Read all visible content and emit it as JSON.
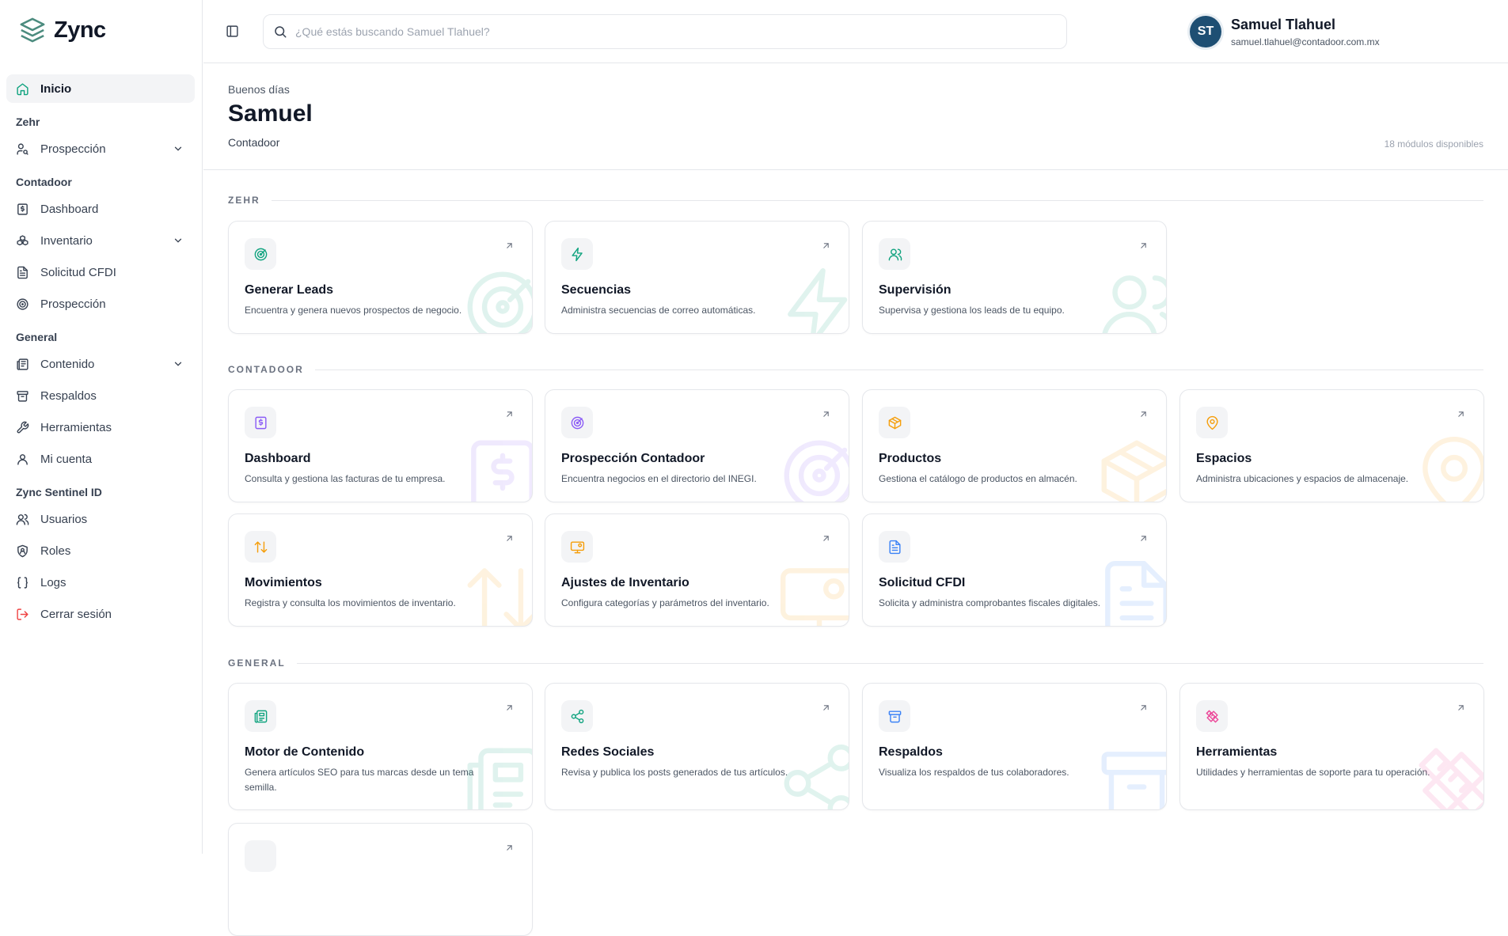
{
  "app": {
    "name": "Zync"
  },
  "sidebar": {
    "home": "Inicio",
    "sections": [
      {
        "title": "Zehr",
        "items": [
          "Prospección"
        ]
      },
      {
        "title": "Contadoor",
        "items": [
          "Dashboard",
          "Inventario",
          "Solicitud CFDI",
          "Prospección"
        ]
      },
      {
        "title": "General",
        "items": [
          "Contenido",
          "Respaldos",
          "Herramientas",
          "Mi cuenta"
        ]
      },
      {
        "title": "Zync Sentinel ID",
        "items": [
          "Usuarios",
          "Roles",
          "Logs",
          "Cerrar sesión"
        ]
      }
    ]
  },
  "search": {
    "placeholder": "¿Qué estás buscando Samuel Tlahuel?"
  },
  "user": {
    "initials": "ST",
    "name": "Samuel Tlahuel",
    "email": "samuel.tlahuel@contadoor.com.mx"
  },
  "header": {
    "greeting": "Buenos días",
    "name": "Samuel",
    "role": "Contadoor",
    "modules": "18 módulos disponibles"
  },
  "groups": [
    {
      "title": "ZEHR",
      "cards": [
        {
          "title": "Generar Leads",
          "desc": "Encuentra y genera nuevos prospectos de negocio.",
          "icon": "target-icon",
          "color": "#10a37f"
        },
        {
          "title": "Secuencias",
          "desc": "Administra secuencias de correo automáticas.",
          "icon": "bolt-icon",
          "color": "#10a37f"
        },
        {
          "title": "Supervisión",
          "desc": "Supervisa y gestiona los leads de tu equipo.",
          "icon": "users-icon",
          "color": "#10a37f"
        }
      ]
    },
    {
      "title": "CONTADOOR",
      "cards": [
        {
          "title": "Dashboard",
          "desc": "Consulta y gestiona las facturas de tu empresa.",
          "icon": "receipt-icon",
          "color": "#8b5cf6"
        },
        {
          "title": "Prospección Contadoor",
          "desc": "Encuentra negocios en el directorio del INEGI.",
          "icon": "target-icon",
          "color": "#8b5cf6"
        },
        {
          "title": "Productos",
          "desc": "Gestiona el catálogo de productos en almacén.",
          "icon": "box-icon",
          "color": "#f59e0b"
        },
        {
          "title": "Espacios",
          "desc": "Administra ubicaciones y espacios de almacenaje.",
          "icon": "pin-icon",
          "color": "#f59e0b"
        },
        {
          "title": "Movimientos",
          "desc": "Registra y consulta los movimientos de inventario.",
          "icon": "swap-icon",
          "color": "#f59e0b"
        },
        {
          "title": "Ajustes de Inventario",
          "desc": "Configura categorías y parámetros del inventario.",
          "icon": "monitor-cog-icon",
          "color": "#f59e0b"
        },
        {
          "title": "Solicitud CFDI",
          "desc": "Solicita y administra comprobantes fiscales digitales.",
          "icon": "file-text-icon",
          "color": "#3b82f6"
        }
      ]
    },
    {
      "title": "GENERAL",
      "cards": [
        {
          "title": "Motor de Contenido",
          "desc": "Genera artículos SEO para tus marcas desde un tema semilla.",
          "icon": "newspaper-icon",
          "color": "#10a37f"
        },
        {
          "title": "Redes Sociales",
          "desc": "Revisa y publica los posts generados de tus artículos.",
          "icon": "share-icon",
          "color": "#10a37f"
        },
        {
          "title": "Respaldos",
          "desc": "Visualiza los respaldos de tus colaboradores.",
          "icon": "archive-icon",
          "color": "#3b82f6"
        },
        {
          "title": "Herramientas",
          "desc": "Utilidades y herramientas de soporte para tu operación.",
          "icon": "tools-icon",
          "color": "#ec4899"
        }
      ]
    }
  ]
}
